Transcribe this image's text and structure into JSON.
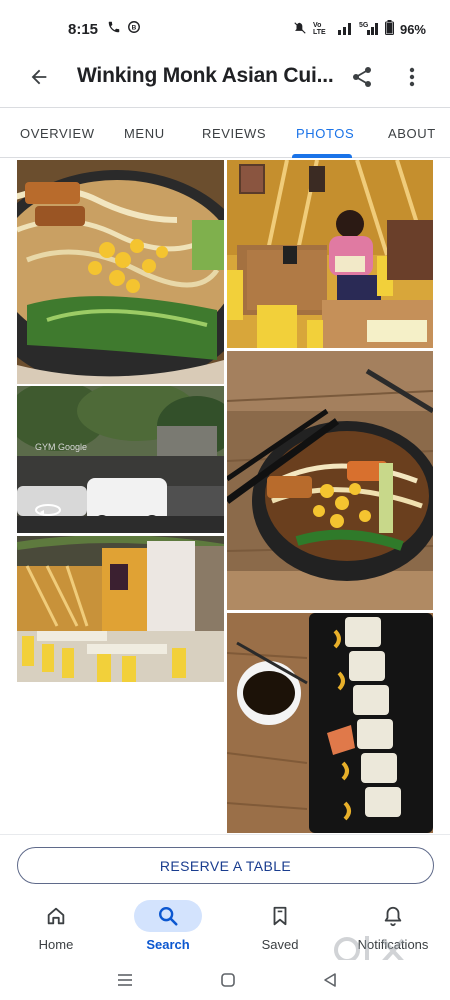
{
  "status_bar": {
    "time": "8:15",
    "battery": "96%",
    "icons": [
      "phone-icon",
      "record-icon",
      "mute-icon",
      "volte-icon",
      "signal-icon",
      "5g-signal-icon",
      "battery-icon"
    ]
  },
  "header": {
    "title": "Winking Monk Asian Cui...",
    "back_icon": "arrow-left-icon",
    "share_icon": "share-icon",
    "more_icon": "more-vert-icon"
  },
  "tabs": [
    {
      "label": "OVERVIEW",
      "active": false
    },
    {
      "label": "MENU",
      "active": false
    },
    {
      "label": "REVIEWS",
      "active": false
    },
    {
      "label": "PHOTOS",
      "active": true
    },
    {
      "label": "ABOUT",
      "active": false
    }
  ],
  "photos": [
    {
      "subject": "ramen bowl with noodles, corn and bok choy"
    },
    {
      "subject": "woman seated at yellow chairs reading menu"
    },
    {
      "subject": "street view of cars and trees",
      "street_view_label": "GYM Google"
    },
    {
      "subject": "ramen bowl with chopsticks on wooden table"
    },
    {
      "subject": "restaurant interior with yellow chairs"
    },
    {
      "subject": "sushi rolls on black plate with soy sauce"
    }
  ],
  "reserve": {
    "label": "RESERVE A TABLE"
  },
  "bottom_nav": [
    {
      "label": "Home",
      "icon": "home-icon",
      "active": false
    },
    {
      "label": "Search",
      "icon": "search-icon",
      "active": true
    },
    {
      "label": "Saved",
      "icon": "bookmark-icon",
      "active": false
    },
    {
      "label": "Notifications",
      "icon": "bell-icon",
      "active": false
    }
  ],
  "system_nav": [
    "recents-icon",
    "home-circle-icon",
    "back-triangle-icon"
  ],
  "colors": {
    "accent": "#1a73e8",
    "active_pill": "#d3e3fd",
    "text_primary": "#202124"
  }
}
